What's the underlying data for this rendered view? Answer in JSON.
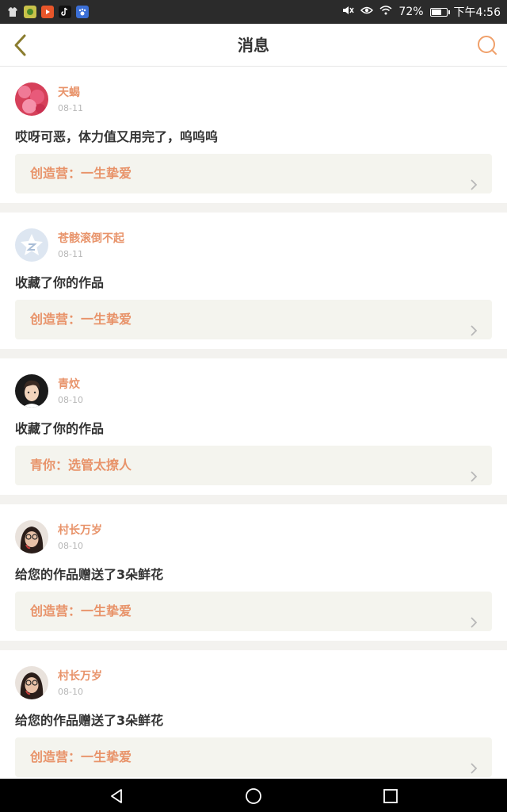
{
  "status_bar": {
    "battery": "72%",
    "battery_level": 0.72,
    "time": "下午4:56",
    "app_icons": [
      "shirt-icon",
      "app-icon-green",
      "video-app-icon",
      "tiktok-icon",
      "paw-icon"
    ],
    "right_icons": [
      "mute-icon",
      "eye-icon",
      "wifi-icon",
      "battery-icon"
    ]
  },
  "header": {
    "title": "消息",
    "back_icon": "back-chevron-icon",
    "search_icon": "search-icon"
  },
  "messages": [
    {
      "username": "天蝎",
      "date": "08-11",
      "text": "哎呀可恶，体力值又用完了，呜呜呜",
      "work": "创造营：一生挚爱",
      "avatar": "pink-flower-avatar"
    },
    {
      "username": "苍骸滚倒不起",
      "date": "08-11",
      "text": "收藏了你的作品",
      "work": "创造营：一生挚爱",
      "avatar": "default-star-avatar"
    },
    {
      "username": "青炆",
      "date": "08-10",
      "text": "收藏了你的作品",
      "work": "青你：选管太撩人",
      "avatar": "cartoon-boy-avatar"
    },
    {
      "username": "村长万岁",
      "date": "08-10",
      "text": "给您的作品赠送了3朵鲜花",
      "work": "创造营：一生挚爱",
      "avatar": "girl-glasses-avatar"
    },
    {
      "username": "村长万岁",
      "date": "08-10",
      "text": "给您的作品赠送了3朵鲜花",
      "work": "创造营：一生挚爱",
      "avatar": "girl-glasses-avatar"
    }
  ],
  "colors": {
    "accent": "#e8936a",
    "header_bg": "#ffffff",
    "page_bg": "#f3f2ef",
    "work_bg": "#f4f4ee"
  },
  "nav_bar": [
    "back-triangle-icon",
    "home-circle-icon",
    "recents-square-icon"
  ]
}
